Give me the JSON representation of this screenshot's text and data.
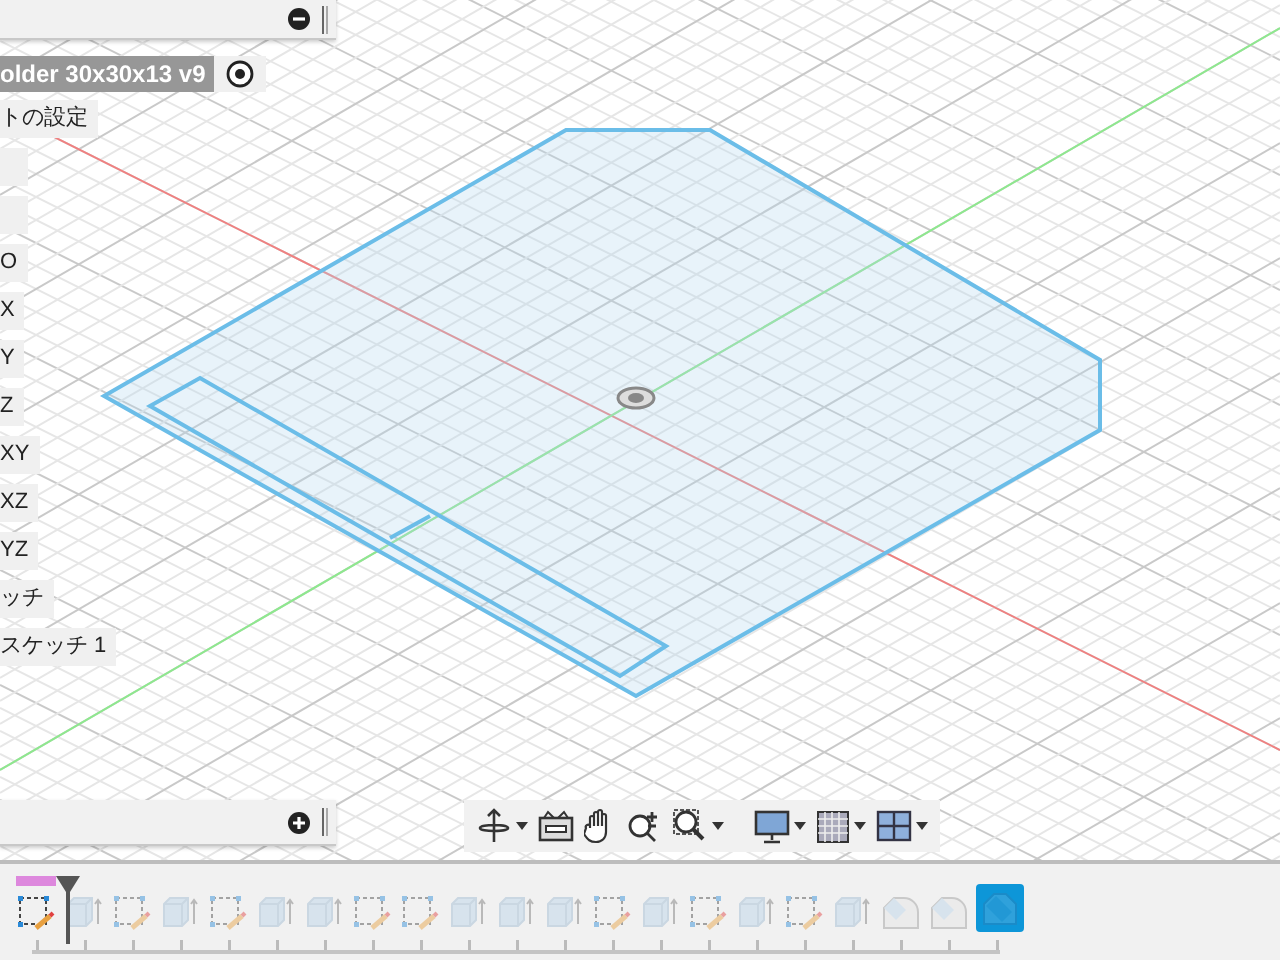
{
  "browser": {
    "title": "older 30x30x13 v9",
    "items": [
      {
        "kind": "label",
        "label": "トの設定"
      },
      {
        "kind": "blank"
      },
      {
        "kind": "blank"
      },
      {
        "kind": "label",
        "label": "O"
      },
      {
        "kind": "label",
        "label": "X"
      },
      {
        "kind": "label",
        "label": "Y"
      },
      {
        "kind": "label",
        "label": "Z"
      },
      {
        "kind": "label",
        "label": "XY"
      },
      {
        "kind": "label",
        "label": "XZ"
      },
      {
        "kind": "label",
        "label": "YZ"
      },
      {
        "kind": "label",
        "label": "ッチ"
      },
      {
        "kind": "label",
        "label": "スケッチ 1"
      }
    ]
  },
  "timeline": [
    {
      "kind": "sketch",
      "rolled_back": false,
      "editing": true,
      "selected": false
    },
    {
      "kind": "extrude",
      "rolled_back": true,
      "editing": false,
      "selected": false
    },
    {
      "kind": "sketch",
      "rolled_back": true,
      "editing": false,
      "selected": false
    },
    {
      "kind": "extrude",
      "rolled_back": true,
      "editing": false,
      "selected": false
    },
    {
      "kind": "sketch",
      "rolled_back": true,
      "editing": false,
      "selected": false
    },
    {
      "kind": "extrude",
      "rolled_back": true,
      "editing": false,
      "selected": false
    },
    {
      "kind": "extrude",
      "rolled_back": true,
      "editing": false,
      "selected": false
    },
    {
      "kind": "sketch",
      "rolled_back": true,
      "editing": false,
      "selected": false
    },
    {
      "kind": "sketch",
      "rolled_back": true,
      "editing": false,
      "selected": false
    },
    {
      "kind": "extrude",
      "rolled_back": true,
      "editing": false,
      "selected": false
    },
    {
      "kind": "extrude",
      "rolled_back": true,
      "editing": false,
      "selected": false
    },
    {
      "kind": "extrude",
      "rolled_back": true,
      "editing": false,
      "selected": false
    },
    {
      "kind": "sketch",
      "rolled_back": true,
      "editing": false,
      "selected": false
    },
    {
      "kind": "extrude",
      "rolled_back": true,
      "editing": false,
      "selected": false
    },
    {
      "kind": "sketch",
      "rolled_back": true,
      "editing": false,
      "selected": false
    },
    {
      "kind": "extrude",
      "rolled_back": true,
      "editing": false,
      "selected": false
    },
    {
      "kind": "sketch",
      "rolled_back": true,
      "editing": false,
      "selected": false
    },
    {
      "kind": "extrude",
      "rolled_back": true,
      "editing": false,
      "selected": false
    },
    {
      "kind": "fillet",
      "rolled_back": true,
      "editing": false,
      "selected": false
    },
    {
      "kind": "fillet",
      "rolled_back": true,
      "editing": false,
      "selected": false
    },
    {
      "kind": "chamfer",
      "rolled_back": true,
      "editing": false,
      "selected": true
    }
  ]
}
